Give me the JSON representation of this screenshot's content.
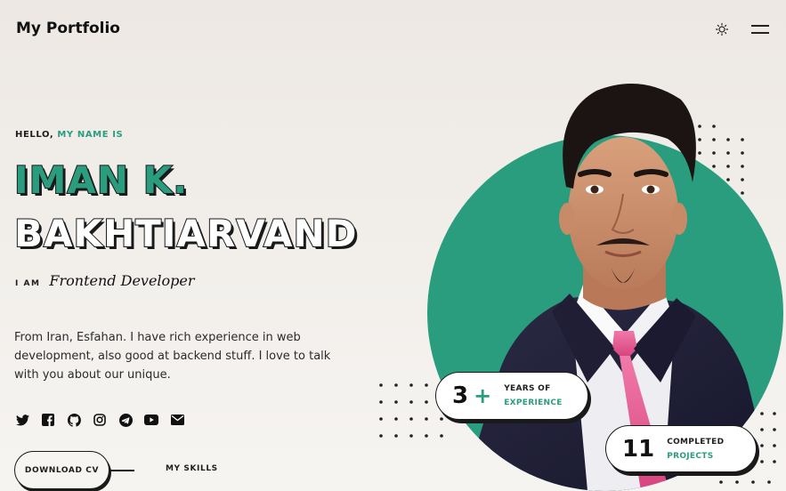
{
  "header": {
    "logo": "My Portfolio",
    "theme_icon": "sun-icon",
    "menu_icon": "hamburger-menu-icon"
  },
  "hero": {
    "hello": "HELLO,",
    "hello_accent": "MY NAME IS",
    "name_line1": "IMAN  K.",
    "name_line2": "BAKHTIARVAND",
    "iam_label": "I AM",
    "role": "Frontend Developer",
    "bio": "From Iran, Esfahan. I have rich experience in web development, also good at backend stuff. I love to talk with you about our unique.",
    "socials": [
      "twitter-icon",
      "facebook-icon",
      "github-icon",
      "instagram-icon",
      "telegram-icon",
      "youtube-icon",
      "email-icon"
    ],
    "download_cv": "DOWNLOAD CV",
    "my_skills": "MY SKILLS"
  },
  "stats": {
    "experience": {
      "number": "3",
      "plus": "+",
      "line1": "YEARS OF",
      "line2": "EXPERIENCE"
    },
    "projects": {
      "number": "11",
      "line1": "COMPLETED",
      "line2": "PROJECTS"
    }
  },
  "colors": {
    "accent": "#2a9d7f",
    "text": "#1d1d1d",
    "background": "#efebe7"
  },
  "portrait": "developer-portrait-illustration"
}
